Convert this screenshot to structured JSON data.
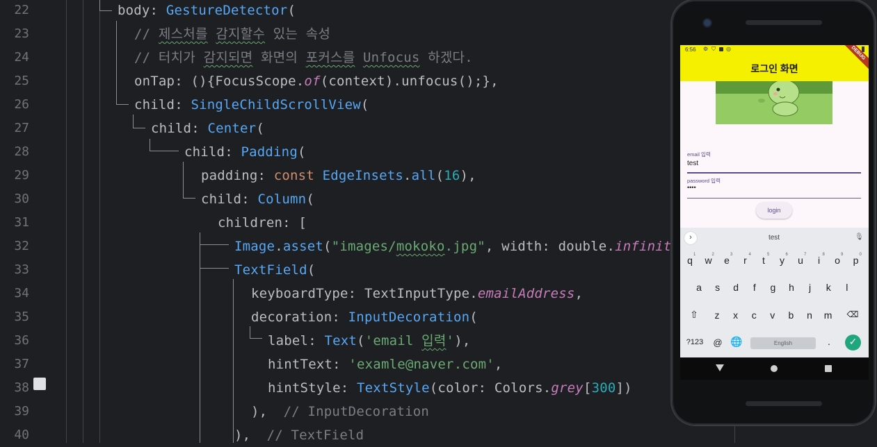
{
  "editor": {
    "line_numbers": [
      "22",
      "23",
      "24",
      "25",
      "26",
      "27",
      "28",
      "29",
      "30",
      "31",
      "32",
      "33",
      "34",
      "35",
      "36",
      "37",
      "38",
      "39",
      "40"
    ],
    "lines": [
      [
        [
          "t",
          "body: "
        ],
        [
          "cls",
          "GestureDetector"
        ],
        [
          "t",
          "("
        ]
      ],
      [
        [
          "cmt",
          "// "
        ],
        [
          "cmtw",
          "제스처를"
        ],
        [
          "cmt",
          " "
        ],
        [
          "cmtw",
          "감지할수"
        ],
        [
          "cmt",
          " 있는 속성"
        ]
      ],
      [
        [
          "cmt",
          "// 터치가 "
        ],
        [
          "cmtw",
          "감지되면"
        ],
        [
          "cmt",
          " 화면의 "
        ],
        [
          "cmtw",
          "포커스를"
        ],
        [
          "cmt",
          " "
        ],
        [
          "cmtw",
          "Unfocus"
        ],
        [
          "cmt",
          " 하겠다."
        ]
      ],
      [
        [
          "t",
          "onTap: (){FocusScope."
        ],
        [
          "ital",
          "of"
        ],
        [
          "t",
          "(context).unfocus();},"
        ]
      ],
      [
        [
          "t",
          "child: "
        ],
        [
          "cls",
          "SingleChildScrollView"
        ],
        [
          "t",
          "("
        ]
      ],
      [
        [
          "t",
          "child: "
        ],
        [
          "cls",
          "Center"
        ],
        [
          "t",
          "("
        ]
      ],
      [
        [
          "t",
          "child: "
        ],
        [
          "cls",
          "Padding"
        ],
        [
          "t",
          "("
        ]
      ],
      [
        [
          "t",
          "padding: "
        ],
        [
          "kw",
          "const "
        ],
        [
          "cls",
          "EdgeInsets"
        ],
        [
          "t",
          "."
        ],
        [
          "fn",
          "all"
        ],
        [
          "t",
          "("
        ],
        [
          "num",
          "16"
        ],
        [
          "t",
          "),"
        ]
      ],
      [
        [
          "t",
          "child: "
        ],
        [
          "cls",
          "Column"
        ],
        [
          "t",
          "("
        ]
      ],
      [
        [
          "t",
          "children: ["
        ]
      ],
      [
        [
          "cls",
          "Image"
        ],
        [
          "t",
          "."
        ],
        [
          "fn",
          "asset"
        ],
        [
          "t",
          "("
        ],
        [
          "str",
          "\"images/"
        ],
        [
          "strw",
          "mokoko"
        ],
        [
          "str",
          ".jpg\""
        ],
        [
          "t",
          ", width: double."
        ],
        [
          "ital",
          "infinity"
        ]
      ],
      [
        [
          "cls",
          "TextField"
        ],
        [
          "t",
          "("
        ]
      ],
      [
        [
          "t",
          "keyboardType: TextInputType."
        ],
        [
          "ital",
          "emailAddress"
        ],
        [
          "t",
          ","
        ]
      ],
      [
        [
          "t",
          "decoration: "
        ],
        [
          "cls",
          "InputDecoration"
        ],
        [
          "t",
          "("
        ]
      ],
      [
        [
          "t",
          "label: "
        ],
        [
          "cls",
          "Text"
        ],
        [
          "t",
          "("
        ],
        [
          "str",
          "'email "
        ],
        [
          "strw",
          "입력"
        ],
        [
          "str",
          "'"
        ],
        [
          "t",
          "),"
        ]
      ],
      [
        [
          "t",
          "hintText: "
        ],
        [
          "str",
          "'examle@naver.com'"
        ],
        [
          "t",
          ","
        ]
      ],
      [
        [
          "t",
          "hintStyle: "
        ],
        [
          "cls",
          "TextStyle"
        ],
        [
          "t",
          "(color: Colors."
        ],
        [
          "ital",
          "grey"
        ],
        [
          "t",
          "["
        ],
        [
          "num",
          "300"
        ],
        [
          "t",
          "])"
        ]
      ],
      [
        [
          "t",
          "),  "
        ],
        [
          "cmt",
          "// InputDecoration"
        ]
      ],
      [
        [
          "t",
          "),  "
        ],
        [
          "cmt",
          "// TextField"
        ]
      ]
    ]
  },
  "phone": {
    "status_time": "6:56",
    "debug_banner": "DEBUG",
    "app_title": "로그인 화면",
    "email_label": "email 입력",
    "email_value": "test",
    "password_label": "password 입력",
    "password_value": "••••",
    "login_label": "login",
    "suggestion": "test",
    "keyboard": {
      "row1": [
        "q",
        "w",
        "e",
        "r",
        "t",
        "y",
        "u",
        "i",
        "o",
        "p"
      ],
      "row1_hints": [
        "1",
        "2",
        "3",
        "4",
        "5",
        "6",
        "7",
        "8",
        "9",
        "0"
      ],
      "row2": [
        "a",
        "s",
        "d",
        "f",
        "g",
        "h",
        "j",
        "k",
        "l"
      ],
      "row3": [
        "z",
        "x",
        "c",
        "v",
        "b",
        "n",
        "m"
      ],
      "sym_label": "?123",
      "at_label": "@",
      "space_label": "English",
      "period_label": "."
    }
  },
  "colors": {
    "editor_bg": "#1e1f22",
    "class": "#56a8f5",
    "keyword": "#cf8e6d",
    "string": "#6aab73",
    "number": "#2aacb8",
    "comment": "#7a7e85",
    "italic_member": "#c77dbb",
    "appbar": "#f5f000",
    "enter_key": "#1fa67a"
  }
}
